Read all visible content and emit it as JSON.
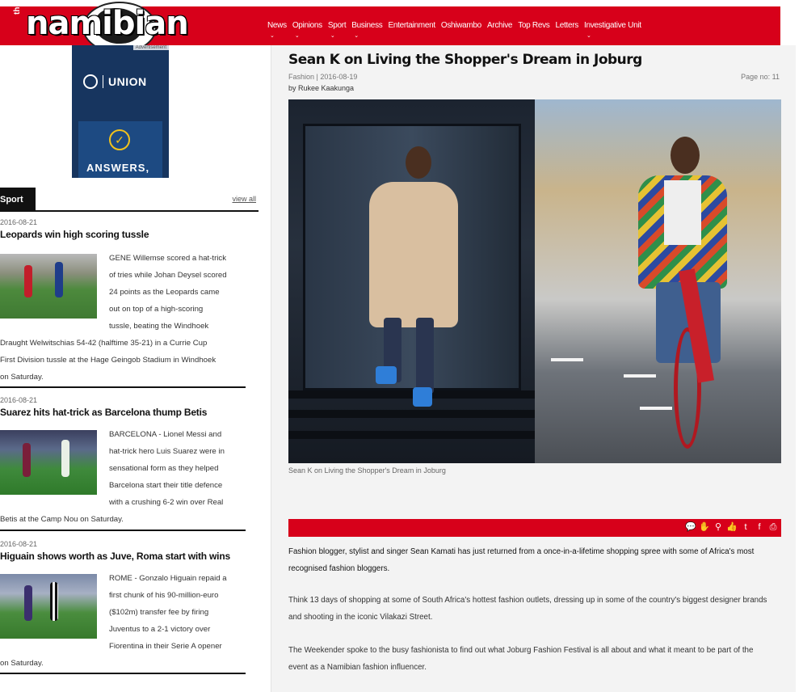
{
  "header": {
    "logo_small": "the",
    "logo_text": "namibian",
    "nav": [
      {
        "label": "News",
        "has_menu": true
      },
      {
        "label": "Opinions",
        "has_menu": true
      },
      {
        "label": "Sport",
        "has_menu": true
      },
      {
        "label": "Business",
        "has_menu": true
      },
      {
        "label": "Entertainment",
        "has_menu": false
      },
      {
        "label": "Oshiwambo",
        "has_menu": false
      },
      {
        "label": "Archive",
        "has_menu": false
      },
      {
        "label": "Top Revs",
        "has_menu": false
      },
      {
        "label": "Letters",
        "has_menu": false
      },
      {
        "label": "Investigative Unit",
        "has_menu": true
      }
    ],
    "caret": "⌄",
    "accent_color": "#d7001a"
  },
  "ad": {
    "tag": "Advertisement",
    "brand": "UNION",
    "check": "✓",
    "text": "ANSWERS,"
  },
  "sidebar": {
    "tab_label": "Sport",
    "view_all": "view all",
    "stories": [
      {
        "date": "2016-08-21",
        "headline": "Leopards win high scoring tussle",
        "excerpt_lines": [
          "GENE Willemse scored a hat-trick",
          "of tries while Johan Deysel scored",
          "24 points as the Leopards came",
          "out on top of a high-scoring",
          "tussle, beating the Windhoek",
          "Draught Welwitschias 54-42 (halftime 35-21) in a Currie Cup",
          "First Division tussle at the Hage Geingob Stadium in Windhoek",
          "on Saturday."
        ]
      },
      {
        "date": "2016-08-21",
        "headline": "Suarez hits hat-trick as Barcelona thump Betis",
        "excerpt_lines": [
          "BARCELONA - Lionel Messi and",
          "hat-trick hero Luis Suarez were in",
          "sensational form as they helped",
          "Barcelona start their title defence",
          "with a crushing 6-2 win over Real",
          "Betis at the Camp Nou on Saturday."
        ]
      },
      {
        "date": "2016-08-21",
        "headline": "Higuain shows worth as Juve, Roma start with wins",
        "excerpt_lines": [
          "ROME - Gonzalo Higuain repaid a",
          "first chunk of his 90-million-euro",
          "($102m) transfer fee by firing",
          "Juventus to a 2-1 victory over",
          "Fiorentina in their Serie A opener",
          "on Saturday."
        ]
      }
    ]
  },
  "article": {
    "title": "Sean K on Living the Shopper's Dream in Joburg",
    "meta": "Fashion | 2016-08-19",
    "byline": "by Rukee Kaakunga",
    "page_no": "Page no: 11",
    "caption": "Sean K on Living the Shopper's Dream in Joburg",
    "share_icons": [
      {
        "name": "comment-icon",
        "glyph": "💬"
      },
      {
        "name": "hand-icon",
        "glyph": "✋"
      },
      {
        "name": "map-pin-icon",
        "glyph": "⚲"
      },
      {
        "name": "thumbs-up-icon",
        "glyph": "👍"
      },
      {
        "name": "twitter-icon",
        "glyph": "t"
      },
      {
        "name": "facebook-icon",
        "glyph": "f"
      },
      {
        "name": "print-icon",
        "glyph": "⎙"
      }
    ],
    "paragraphs": [
      "Fashion blogger, stylist and singer Sean Kamati has just returned from a once-in-a-lifetime shopping spree with some of Africa's most recognised fashion bloggers.",
      "Think 13 days of shopping at some of South Africa's hottest fashion outlets, dressing up in some of the country's biggest designer brands and shooting in the iconic Vilakazi Street.",
      "The Weekender spoke to the busy fashionista to find out what Joburg Fashion Festival is all about and what it meant to be part of the event as a Namibian fashion influencer."
    ]
  }
}
